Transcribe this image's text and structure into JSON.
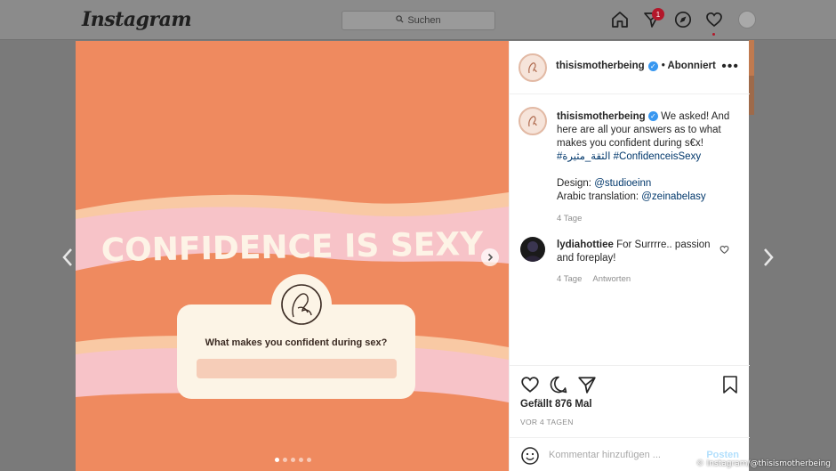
{
  "topbar": {
    "logo": "Instagram",
    "search_placeholder": "Suchen",
    "notification_count": "1"
  },
  "post": {
    "image": {
      "headline": "CONFIDENCE IS SEXY",
      "question": "What makes you confident during sex?",
      "carousel_total": 5,
      "carousel_active": 1
    },
    "author": {
      "username": "thisismotherbeing",
      "verified": true,
      "follow_label": "• Abonniert"
    },
    "caption": {
      "username": "thisismotherbeing",
      "text": "We asked! And here are all your answers as to what makes you confident during s€x!",
      "hashtags": "#الثقة_مثيرة #ConfidenceisSexy",
      "design_label": "Design: ",
      "design_handle": "@studioeinn",
      "translation_label": "Arabic translation: ",
      "translation_handle": "@zeinabelasy",
      "age": "4 Tage"
    },
    "comment": {
      "username": "lydiahottiee",
      "text": "For Surrrre.. passion and foreplay!",
      "age": "4 Tage",
      "reply_label": "Antworten"
    },
    "likes": "Gefällt 876 Mal",
    "date": "VOR 4 TAGEN",
    "comment_placeholder": "Kommentar hinzufügen ...",
    "post_button": "Posten"
  },
  "credit": "© Instagram/@thisismotherbeing",
  "colors": {
    "image_bg": "#ef8a5f",
    "band_pink": "#f7c3c8",
    "band_peach": "#f9c9a4",
    "card": "#fcf4e6",
    "link": "#00376b",
    "verified": "#3897f0"
  }
}
